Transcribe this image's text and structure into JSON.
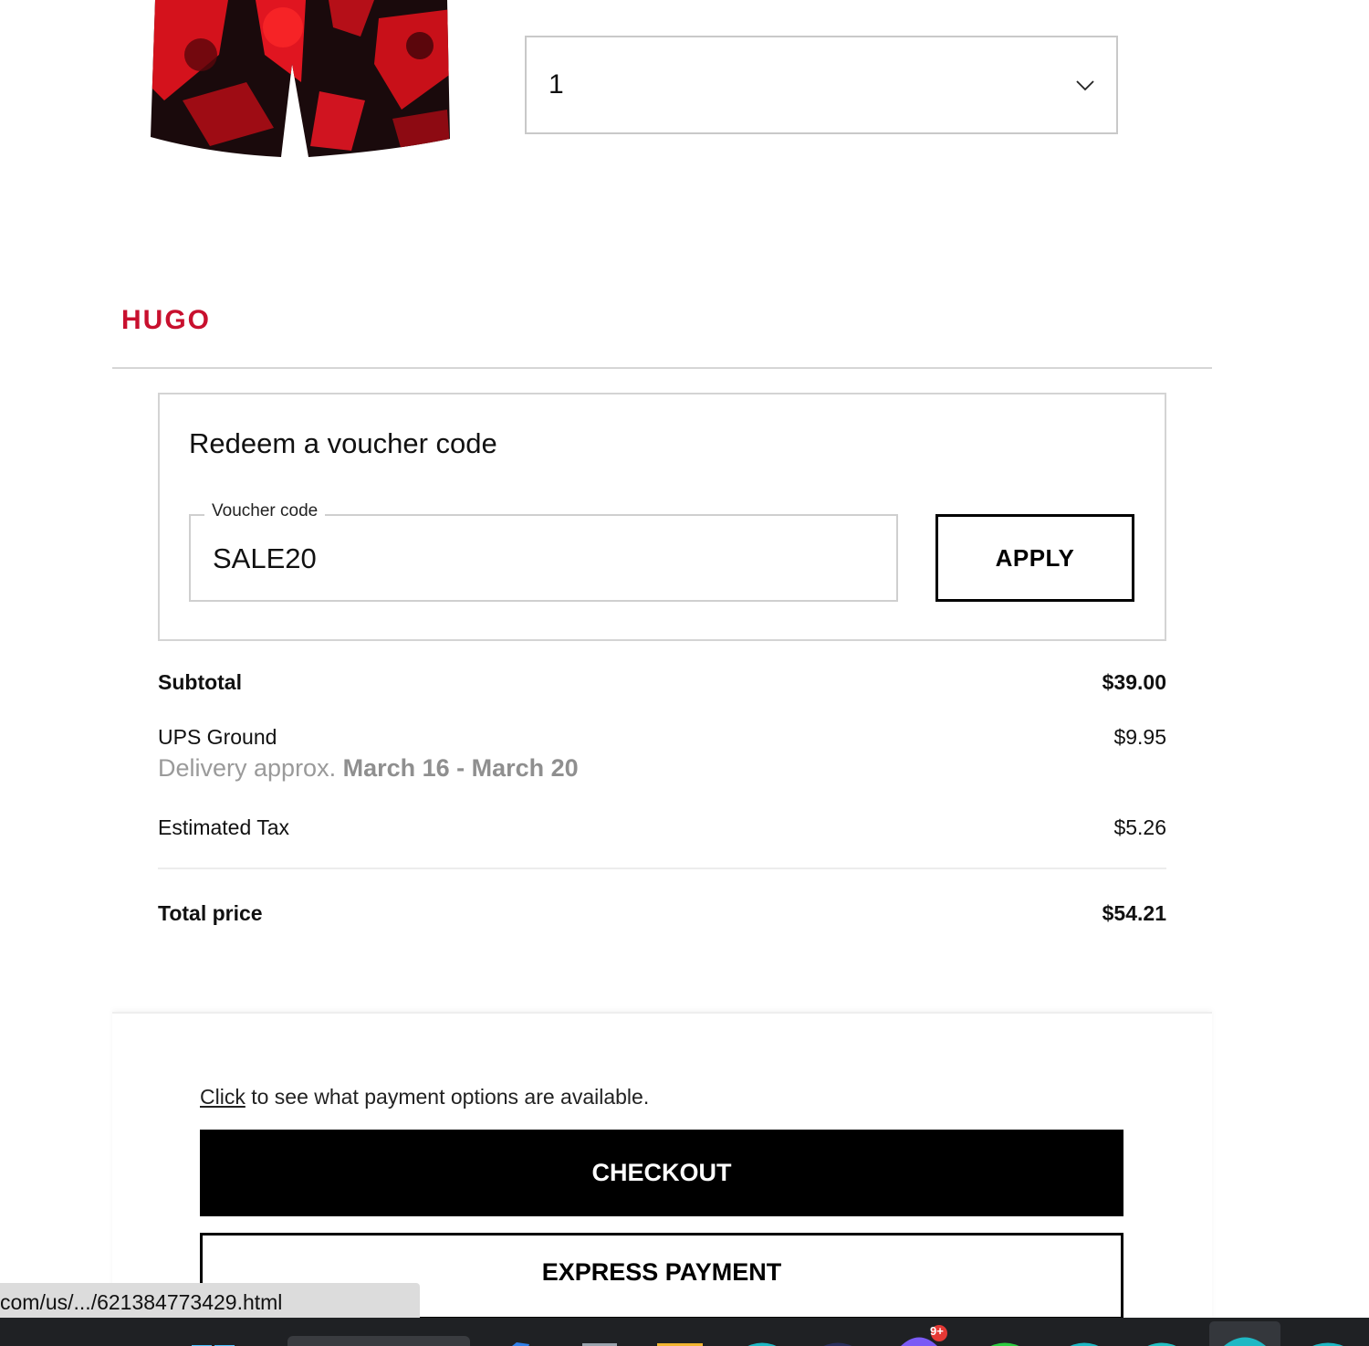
{
  "product": {
    "image_icon": "swim-shorts-image",
    "quantity_selected": "1"
  },
  "brand": {
    "name": "HUGO",
    "color": "#c8102e"
  },
  "voucher": {
    "title": "Redeem a voucher code",
    "field_label": "Voucher code",
    "field_value": "SALE20",
    "apply_label": "APPLY"
  },
  "summary": {
    "subtotal_label": "Subtotal",
    "subtotal_value": "$39.00",
    "shipping_label": "UPS Ground",
    "shipping_value": "$9.95",
    "delivery_prefix": "Delivery approx.",
    "delivery_range": "March 16 - March 20",
    "tax_label": "Estimated Tax",
    "tax_value": "$5.26",
    "total_label": "Total price",
    "total_value": "$54.21"
  },
  "checkout": {
    "payment_link": "Click",
    "payment_text": " to see what payment options are available.",
    "checkout_label": "CHECKOUT",
    "express_label": "EXPRESS PAYMENT"
  },
  "status_bar": {
    "url": "com/us/.../621384773429.html"
  },
  "taskbar": {
    "notification_badge": "9+"
  }
}
